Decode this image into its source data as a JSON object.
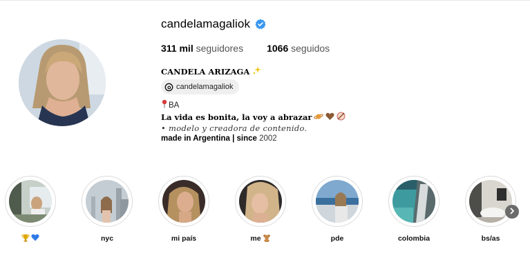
{
  "profile": {
    "username": "candelamagaliok",
    "followers_count": "311 mil",
    "followers_label": "seguidores",
    "following_count": "1066",
    "following_label": "seguidos",
    "full_name": "CANDELA ARIZAGA",
    "threads_handle": "candelamagaliok"
  },
  "bio": {
    "location": "BA",
    "line2": "La vida es bonita, la voy a abrazar",
    "line3": "• modelo y creadora de contenido.",
    "line4_bold": "made in Argentina | since",
    "line4_year": "2002"
  },
  "highlights": [
    {
      "label": ""
    },
    {
      "label": "nyc"
    },
    {
      "label": "mi país"
    },
    {
      "label": "me"
    },
    {
      "label": "pde"
    },
    {
      "label": "colombia"
    },
    {
      "label": "bs/as"
    }
  ],
  "colors": {
    "verified_badge": "#3897f0",
    "secondary_text": "#555555",
    "chip_background": "#efefef"
  },
  "icons": [
    "verified-badge-icon",
    "threads-icon",
    "pin-icon",
    "sparkle-icon",
    "planet-icon",
    "heart-icon",
    "bow-arrow-icon",
    "trophy-icon",
    "blue-heart-icon",
    "teddy-bear-icon",
    "chevron-right-icon"
  ]
}
